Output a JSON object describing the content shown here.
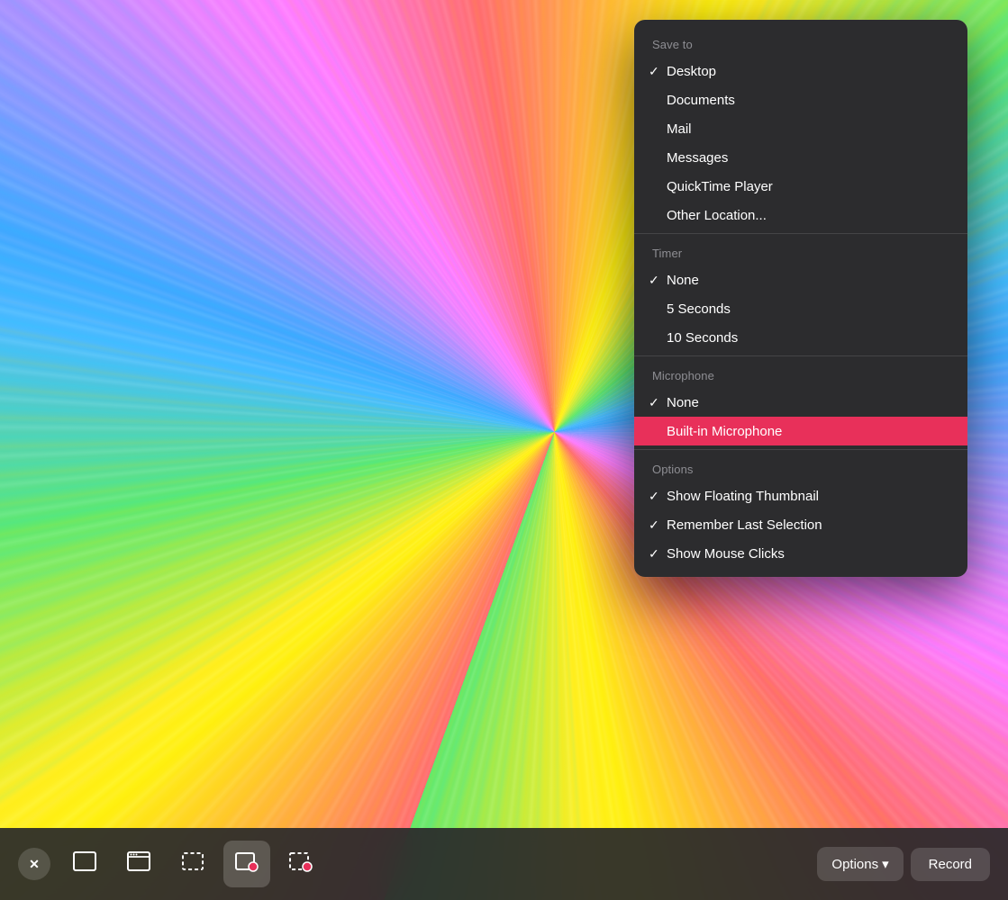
{
  "background": {
    "description": "Colorful burst wallpaper"
  },
  "dropdown": {
    "save_to_header": "Save to",
    "save_to_items": [
      {
        "label": "Desktop",
        "checked": true
      },
      {
        "label": "Documents",
        "checked": false
      },
      {
        "label": "Mail",
        "checked": false
      },
      {
        "label": "Messages",
        "checked": false
      },
      {
        "label": "QuickTime Player",
        "checked": false
      },
      {
        "label": "Other Location...",
        "checked": false
      }
    ],
    "timer_header": "Timer",
    "timer_items": [
      {
        "label": "None",
        "checked": true
      },
      {
        "label": "5 Seconds",
        "checked": false
      },
      {
        "label": "10 Seconds",
        "checked": false
      }
    ],
    "microphone_header": "Microphone",
    "microphone_items": [
      {
        "label": "None",
        "checked": true,
        "highlighted": false
      },
      {
        "label": "Built-in Microphone",
        "checked": false,
        "highlighted": true
      }
    ],
    "options_header": "Options",
    "options_items": [
      {
        "label": "Show Floating Thumbnail",
        "checked": true
      },
      {
        "label": "Remember Last Selection",
        "checked": true
      },
      {
        "label": "Show Mouse Clicks",
        "checked": true
      }
    ]
  },
  "toolbar": {
    "close_label": "✕",
    "options_label": "Options",
    "options_chevron": "▾",
    "record_label": "Record",
    "buttons": [
      {
        "name": "capture-entire-screen",
        "title": "Capture Entire Screen"
      },
      {
        "name": "capture-window",
        "title": "Capture Window"
      },
      {
        "name": "capture-selection",
        "title": "Capture Selection"
      },
      {
        "name": "record-screen",
        "title": "Record Entire Screen"
      },
      {
        "name": "record-selection",
        "title": "Record Selection"
      }
    ]
  }
}
